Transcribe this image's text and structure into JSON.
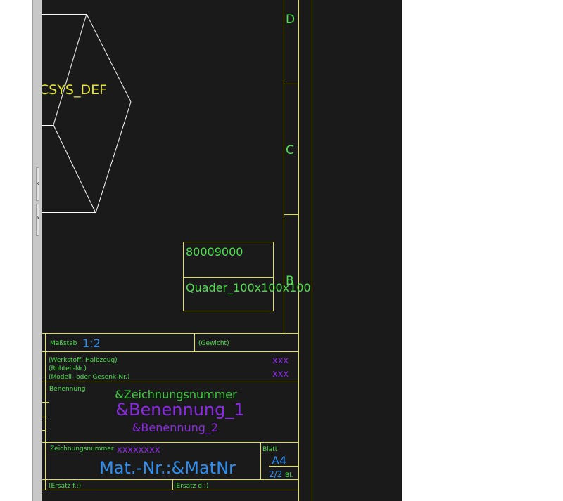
{
  "colors": {
    "frame": "#e4e43a",
    "geometry": "#ffffff",
    "label_green": "#4de04d",
    "title_green": "#3fcf3f",
    "title_purple": "#8a2be2",
    "title_blue": "#2f8ff0",
    "canvas_bg": "#1b1a1b"
  },
  "splitter": {
    "collapse_left_glyph": "‹",
    "expand_right_glyph": "›"
  },
  "drawing": {
    "csys_label": "CSYS_DEF",
    "zone_labels": [
      "D",
      "C",
      "B"
    ],
    "part_box": {
      "number": "80009000",
      "name": "Quader_100x100x100"
    }
  },
  "title_block": {
    "massstab_label": "Maßstab",
    "massstab_value": "1:2",
    "gewicht_label": "(Gewicht)",
    "werkstoff_label": "(Werkstoff, Halbzeug)",
    "rohteil_label": "(Rohteil-Nr.)",
    "modell_label": "(Modell- oder Gesenk-Nr.)",
    "werkstoff_value": "xxx",
    "rohteil_value": "xxx",
    "benennung_label": "Benennung",
    "zeichnungsnummer_param": "&Zeichnungsnummer",
    "benennung_1": "&Benennung_1",
    "benennung_2": "&Benennung_2",
    "zeichnungsnummer_label": "Zeichnungsnummer",
    "zeichnungsnummer_value": "xxxxxxxx",
    "matnr": "Mat.-Nr.:&MatNr",
    "blatt_label": "Blatt",
    "format": "A4",
    "sheet": "2/2",
    "bl": "Bl.",
    "ersatz_fuer": "(Ersatz f.:)",
    "ersatz_durch": "(Ersatz d.:)"
  }
}
